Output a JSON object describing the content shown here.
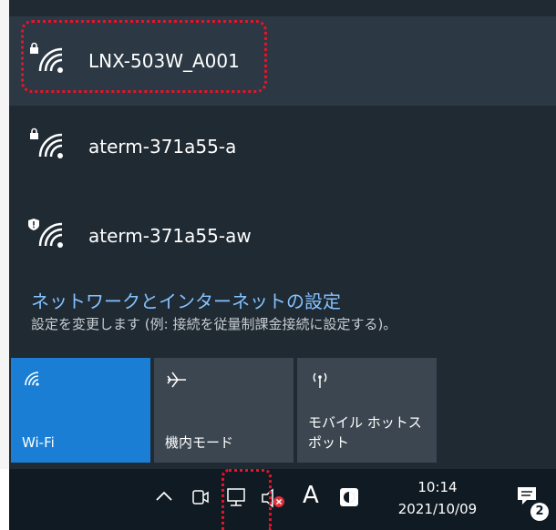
{
  "networks": [
    {
      "name": "LNX-503W_A001",
      "secure_icon": "lock-icon",
      "selected": true
    },
    {
      "name": "aterm-371a55-a",
      "secure_icon": "lock-icon",
      "selected": false
    },
    {
      "name": "aterm-371a55-aw",
      "secure_icon": "shield-warning-icon",
      "selected": false
    }
  ],
  "settings": {
    "title": "ネットワークとインターネットの設定",
    "description": "設定を変更します (例: 接続を従量制課金接続に設定する)。"
  },
  "quick_actions": [
    {
      "label": "Wi-Fi",
      "icon": "wifi-icon",
      "active": true
    },
    {
      "label": "機内モード",
      "icon": "airplane-icon",
      "active": false
    },
    {
      "label": "モバイル ホットス\nポット",
      "icon": "mobile-hotspot-icon",
      "active": false
    }
  ],
  "taskbar": {
    "ime_label": "A",
    "time": "10:14",
    "date": "2021/10/09",
    "notification_count": "2",
    "icons": [
      "chevron-up-icon",
      "meet-now-icon",
      "network-icon",
      "speaker-muted-icon",
      "ime-icon",
      "app-tray-icon",
      "action-center-icon"
    ]
  },
  "colors": {
    "flyout_bg": "#1f2a33",
    "accent": "#1a7fd4",
    "link": "#84c2ff",
    "highlight_box": "#e8132a"
  }
}
